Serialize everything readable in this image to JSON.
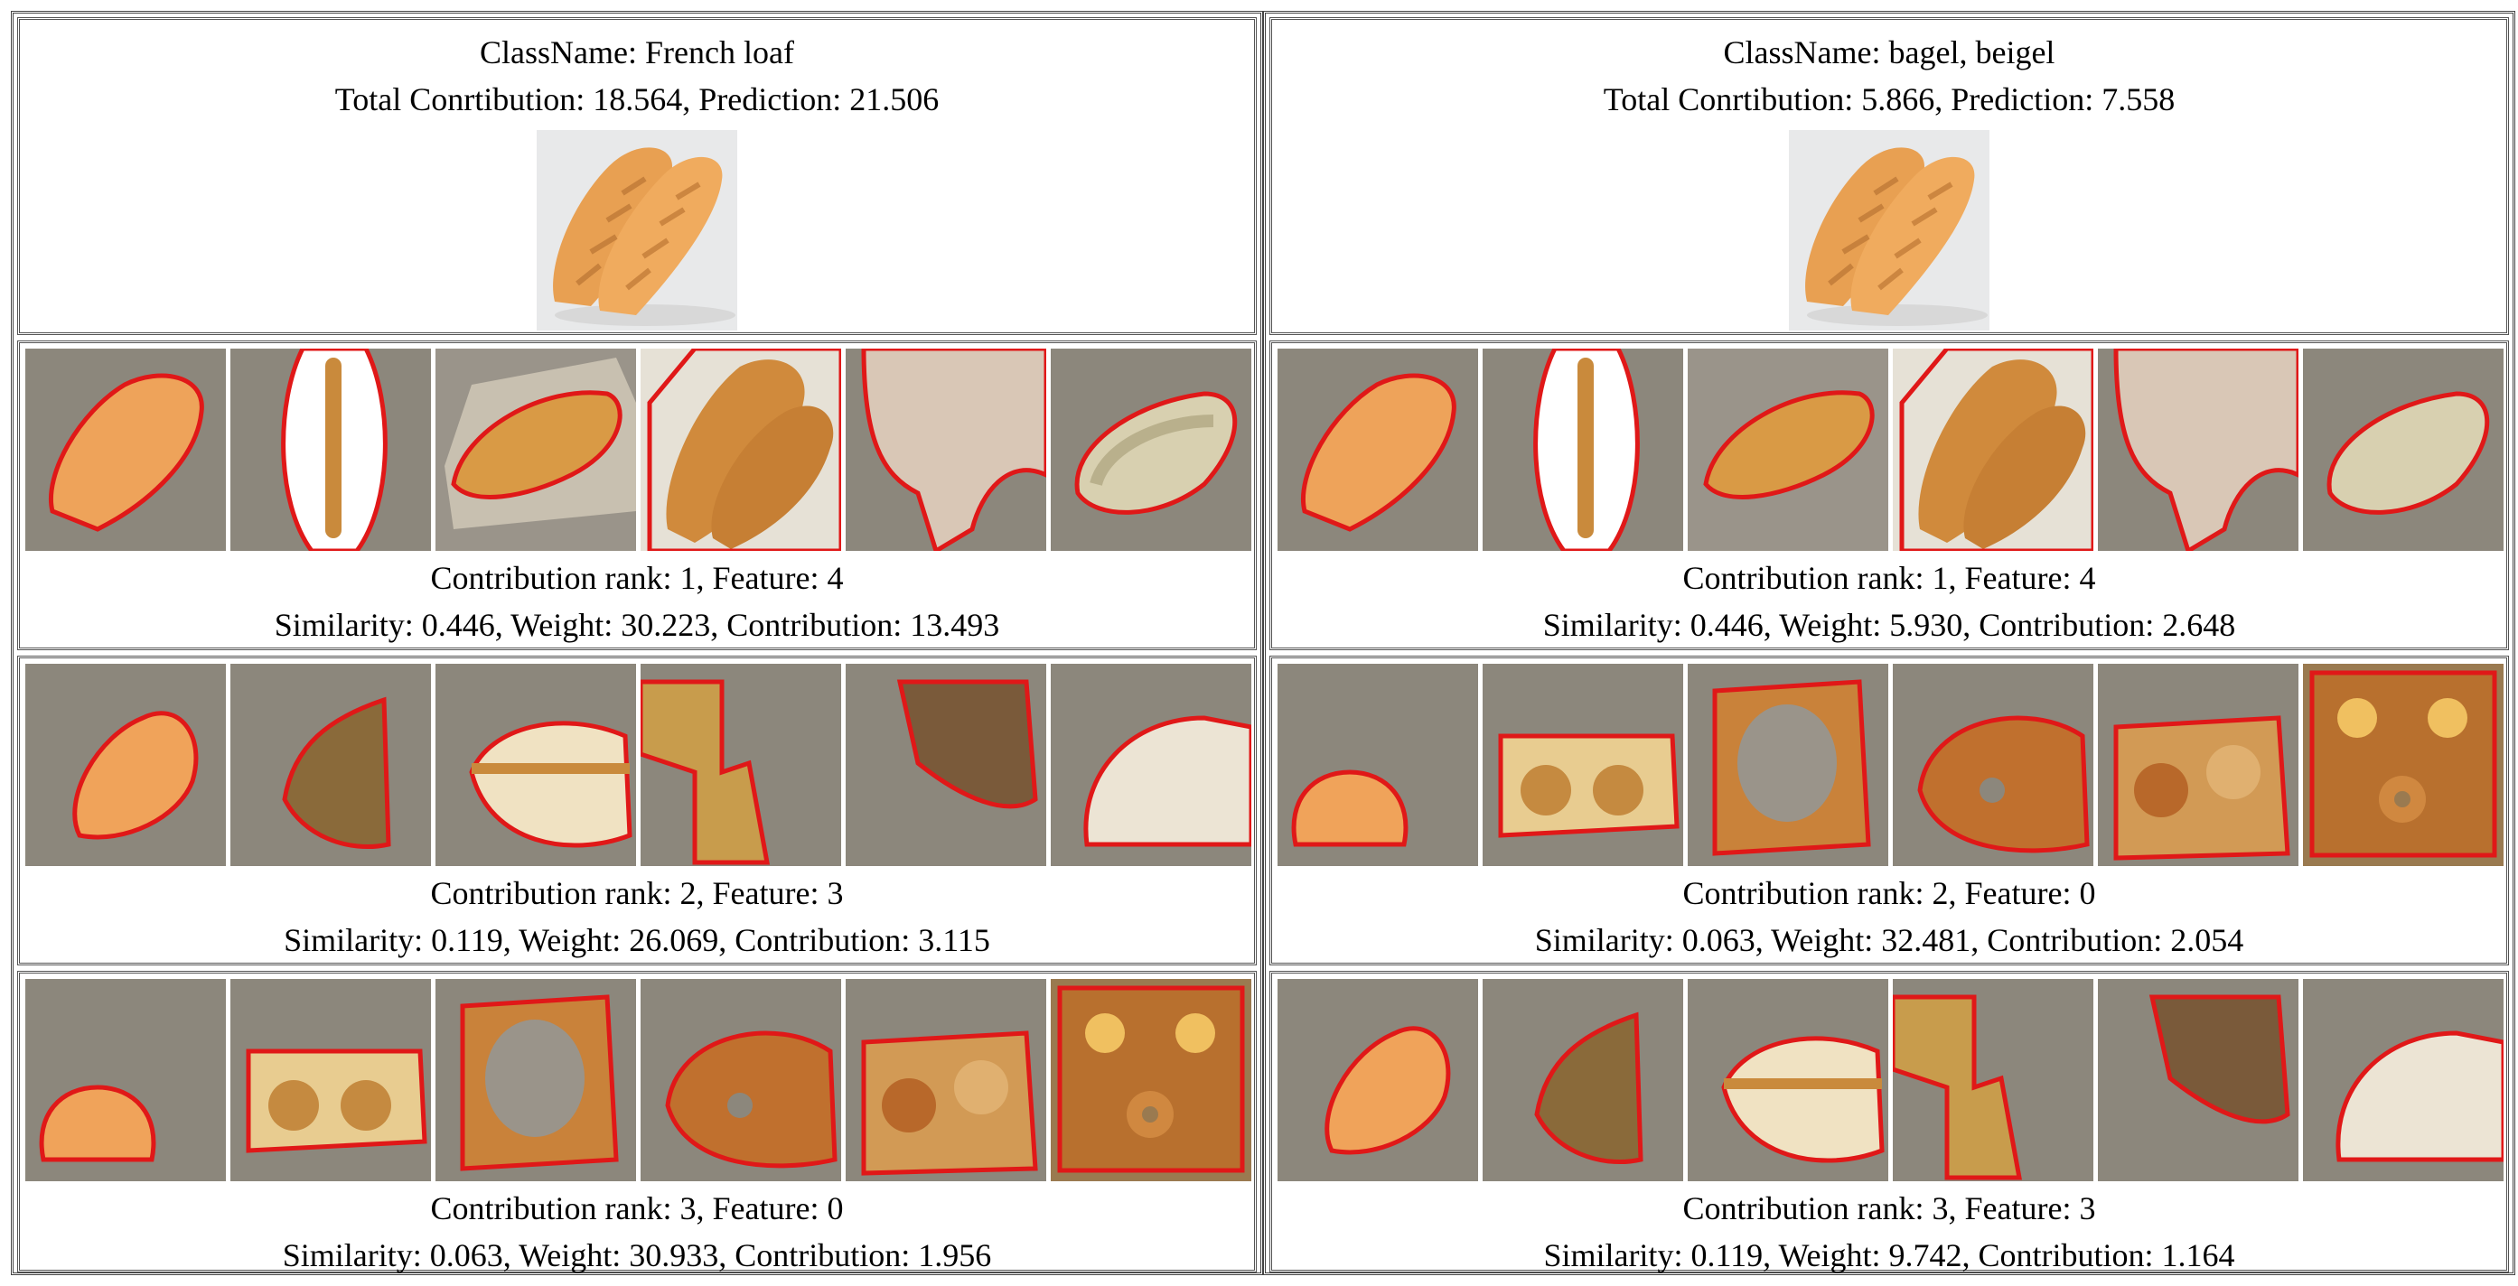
{
  "panels": [
    {
      "class_name": "ClassName: French loaf",
      "totals": "Total Conrtibution: 18.564, Prediction: 21.506",
      "rows": [
        {
          "rank_line": "Contribution rank: 1, Feature: 4",
          "stats_line": "Similarity: 0.446, Weight: 30.223, Contribution: 13.493",
          "theme": "loaf"
        },
        {
          "rank_line": "Contribution rank: 2, Feature: 3",
          "stats_line": "Similarity: 0.119, Weight: 26.069, Contribution: 3.115",
          "theme": "crumb"
        },
        {
          "rank_line": "Contribution rank: 3, Feature: 0",
          "stats_line": "Similarity: 0.063, Weight: 30.933, Contribution: 1.956",
          "theme": "bagel"
        }
      ]
    },
    {
      "class_name": "ClassName: bagel, beigel",
      "totals": "Total Conrtibution: 5.866, Prediction: 7.558",
      "rows": [
        {
          "rank_line": "Contribution rank: 1, Feature: 4",
          "stats_line": "Similarity: 0.446, Weight: 5.930, Contribution: 2.648",
          "theme": "loaf"
        },
        {
          "rank_line": "Contribution rank: 2, Feature: 0",
          "stats_line": "Similarity: 0.063, Weight: 32.481, Contribution: 2.054",
          "theme": "bagel"
        },
        {
          "rank_line": "Contribution rank: 3, Feature: 3",
          "stats_line": "Similarity: 0.119, Weight: 9.742, Contribution: 1.164",
          "theme": "crumb"
        }
      ]
    }
  ],
  "colors": {
    "outline": "#e01818",
    "loaf_crust": "#e8a25a",
    "crumb": "#f0e0c0",
    "bagel": "#c07030",
    "dim_bg": "#8c877c"
  }
}
